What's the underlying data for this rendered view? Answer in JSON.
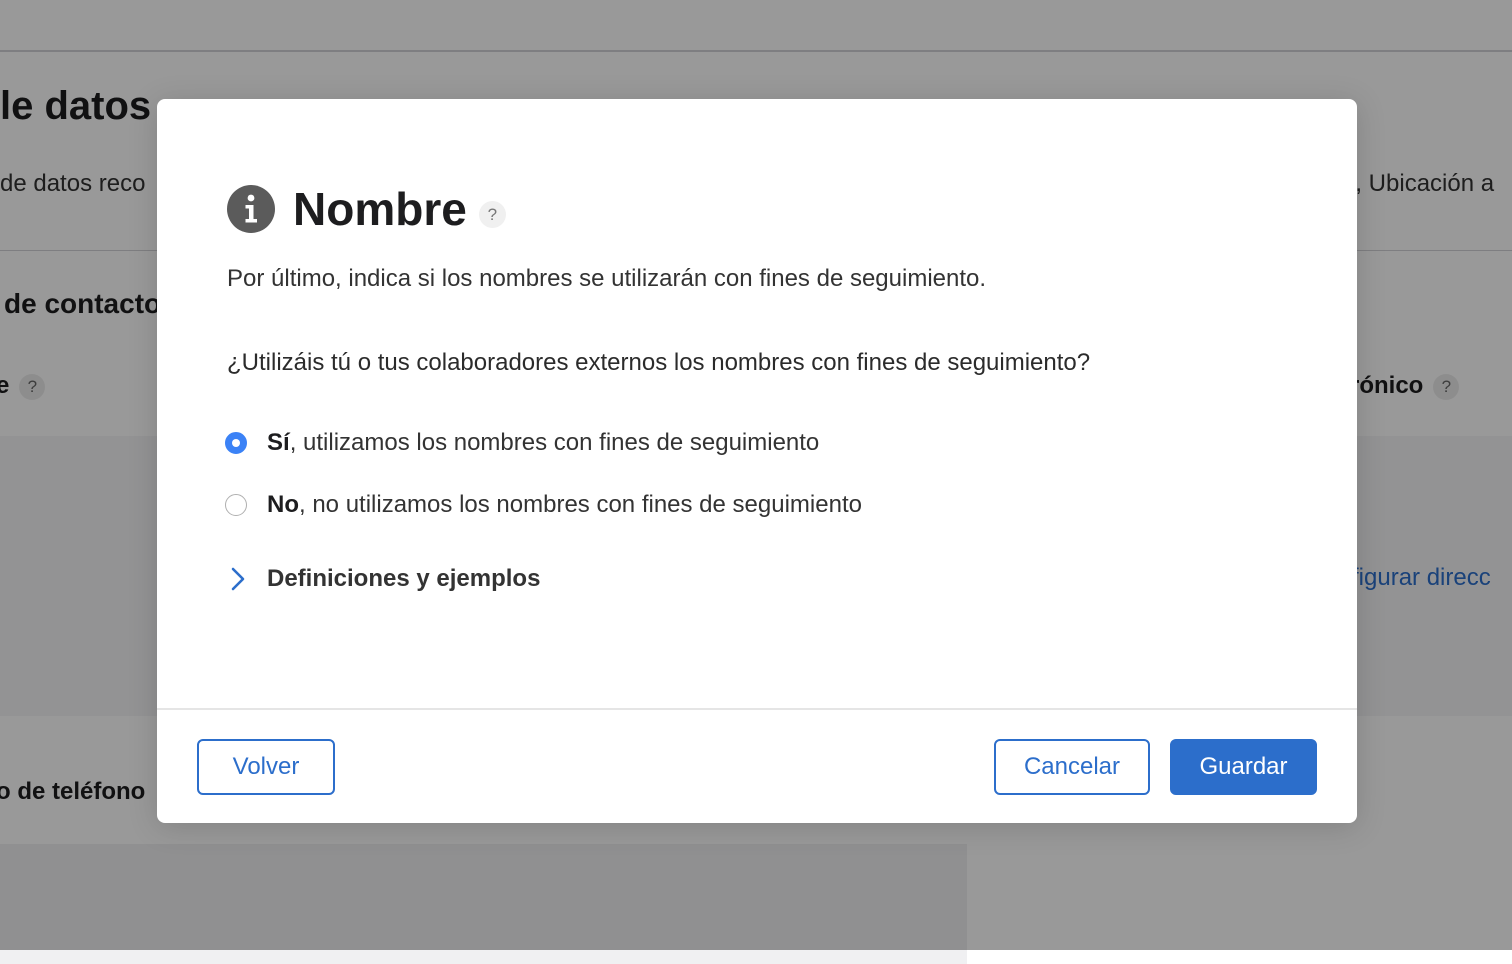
{
  "background": {
    "heading": "le datos",
    "description_left": "de datos reco",
    "description_right": "a, Ubicación a",
    "section_title": "de contacto",
    "field_left_label": "e",
    "field_right_label": "trónico",
    "help_symbol": "?",
    "link_text": "figurar direcc",
    "phone_label": "o de teléfono"
  },
  "modal": {
    "icon": "info-icon",
    "title": "Nombre",
    "help_symbol": "?",
    "description": "Por último, indica si los nombres se utilizarán con fines de seguimiento.",
    "question": "¿Utilizáis tú o tus colaboradores externos los nombres con fines de seguimiento?",
    "options": [
      {
        "bold": "Sí",
        "text": ", utilizamos los nombres con fines de seguimiento",
        "selected": true
      },
      {
        "bold": "No",
        "text": ", no utilizamos los nombres con fines de seguimiento",
        "selected": false
      }
    ],
    "disclosure_label": "Definiciones y ejemplos",
    "disclosure_icon": "chevron-right-icon",
    "buttons": {
      "back": "Volver",
      "cancel": "Cancelar",
      "save": "Guardar"
    }
  },
  "colors": {
    "accent": "#2c6ecb",
    "radio_selected": "#3b82f6",
    "overlay": "rgba(0,0,0,0.40)"
  }
}
